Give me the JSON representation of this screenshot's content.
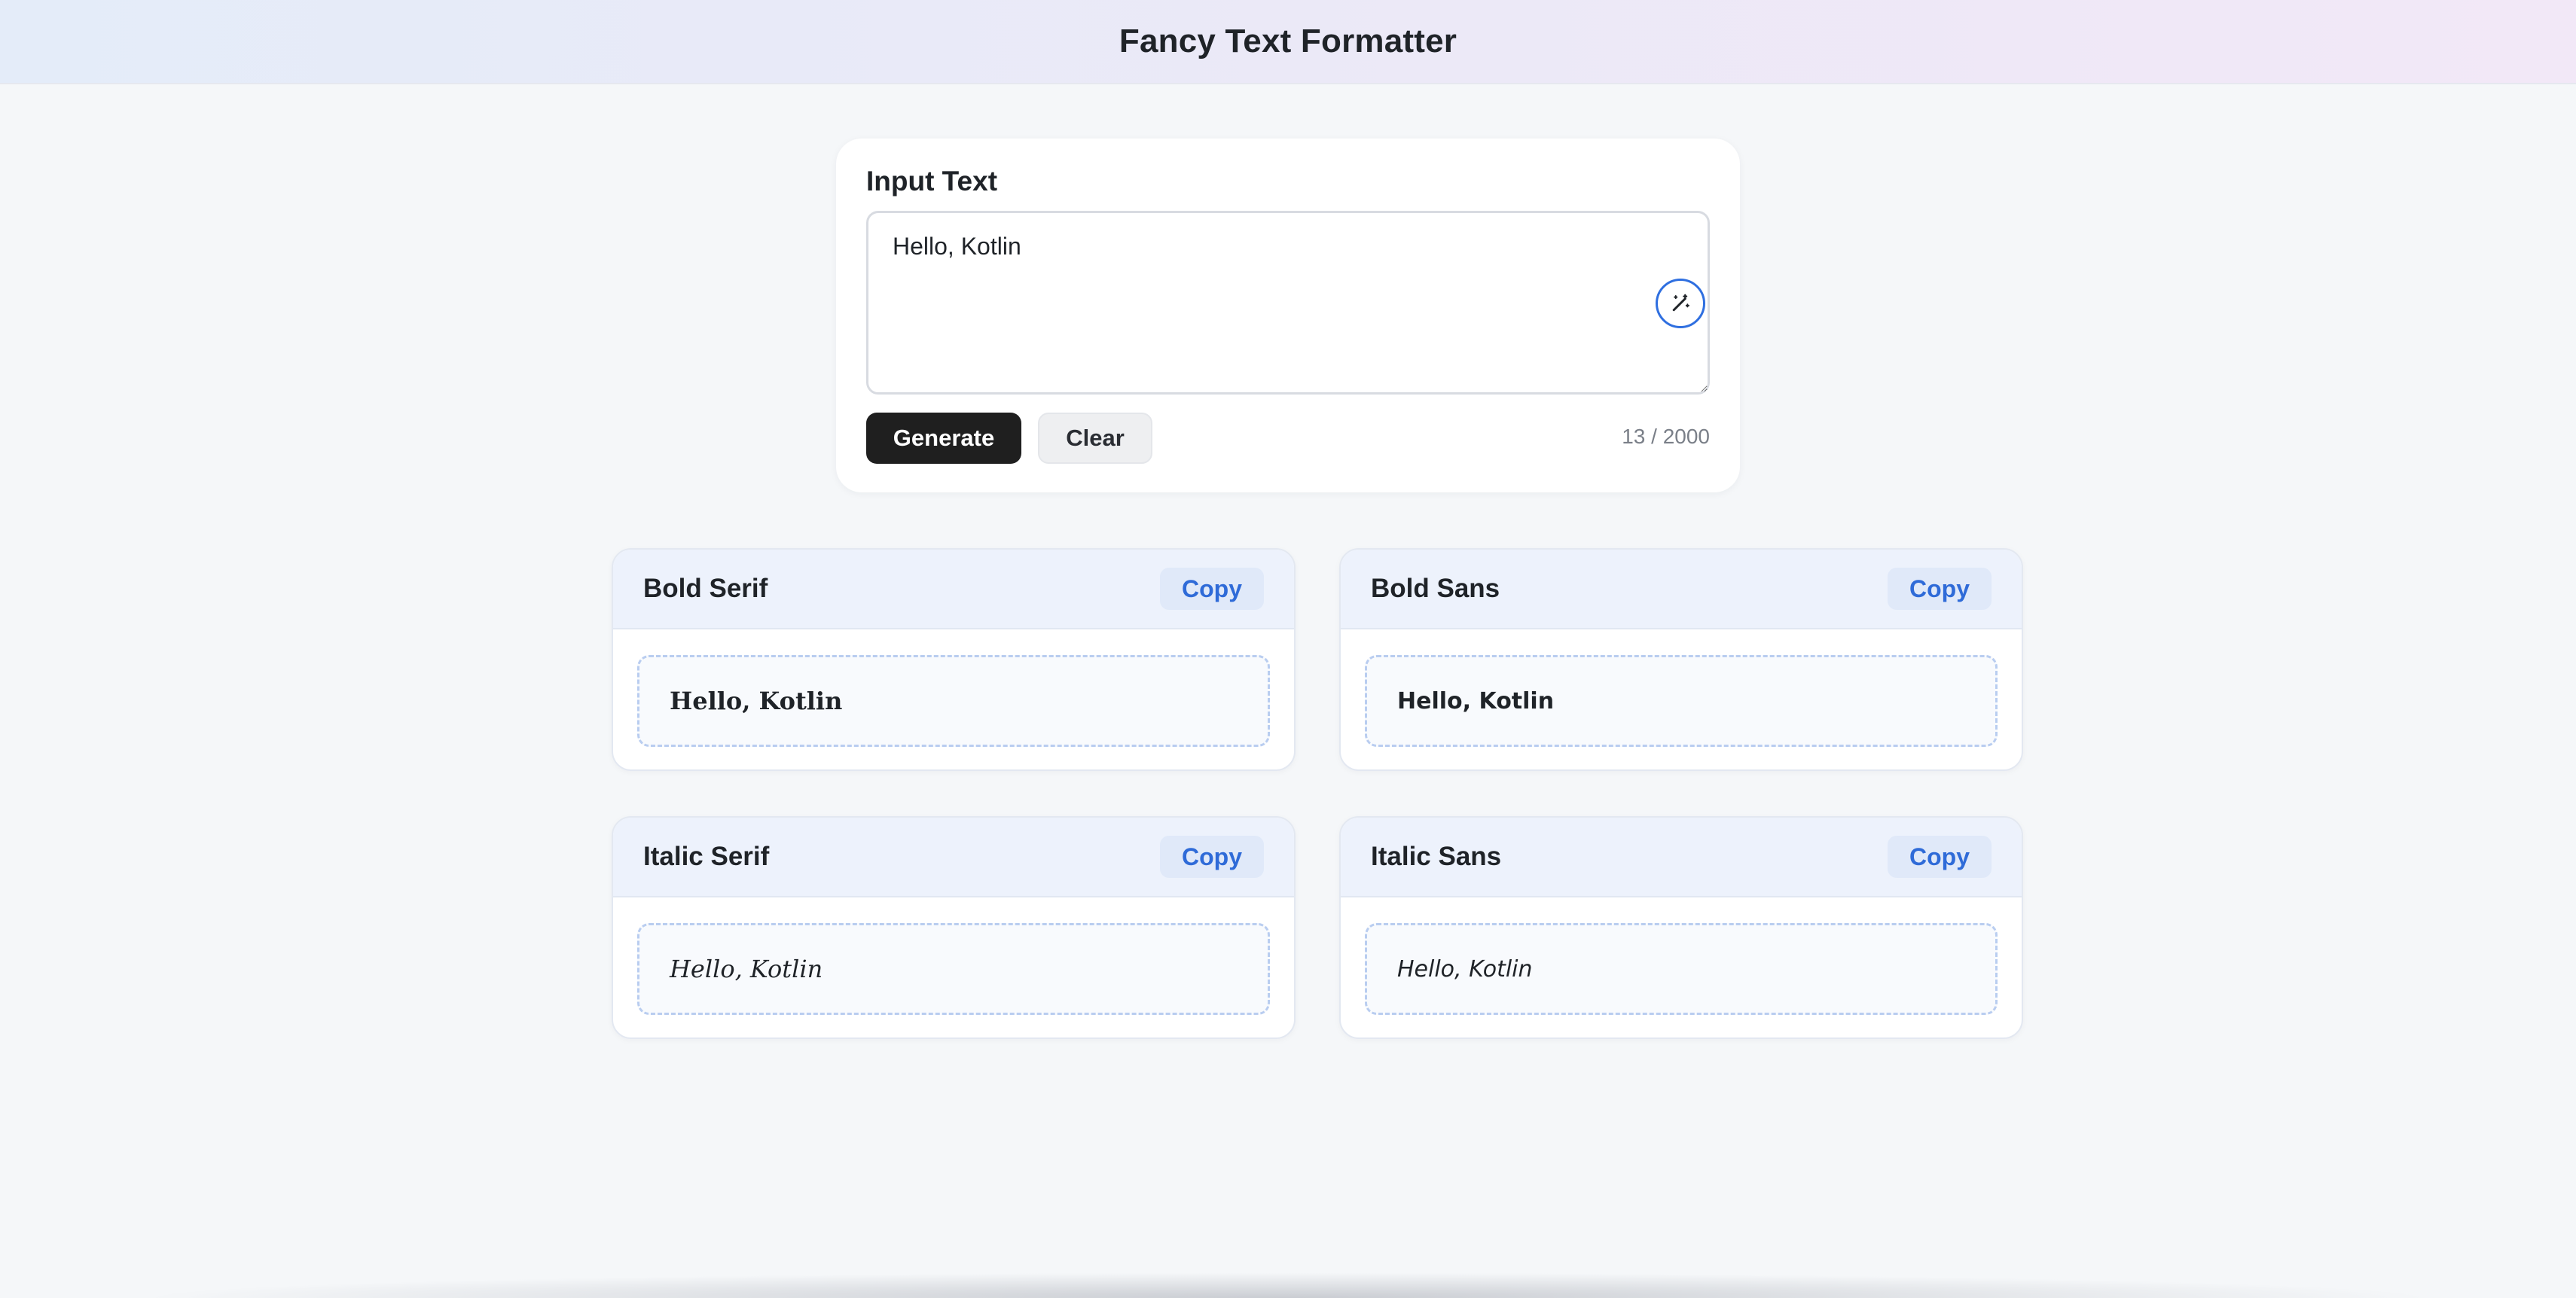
{
  "header": {
    "title": "Fancy Text Formatter"
  },
  "input": {
    "label": "Input Text",
    "value": "Hello, Kotlin",
    "generate_label": "Generate",
    "clear_label": "Clear",
    "char_count": "13 / 2000",
    "magic_icon": "magic-wand-icon"
  },
  "results": [
    {
      "title": "Bold Serif",
      "copy_label": "Copy",
      "output": "Hello, Kotlin"
    },
    {
      "title": "Bold Sans",
      "copy_label": "Copy",
      "output": "Hello, Kotlin"
    },
    {
      "title": "Italic Serif",
      "copy_label": "Copy",
      "output": "Hello, Kotlin"
    },
    {
      "title": "Italic Sans",
      "copy_label": "Copy",
      "output": "Hello, Kotlin"
    }
  ],
  "colors": {
    "accent": "#2f6bd8",
    "primary_button": "#1f1f1f",
    "card_header": "#edf2fc"
  }
}
